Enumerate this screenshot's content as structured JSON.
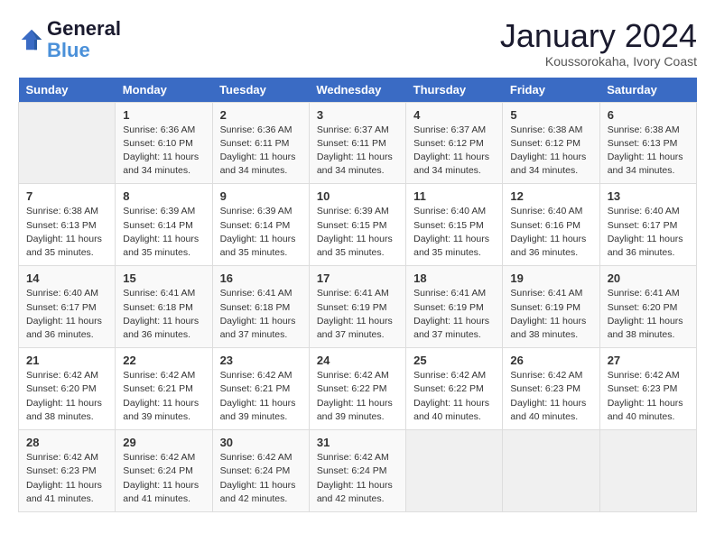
{
  "logo": {
    "line1": "General",
    "line2": "Blue"
  },
  "title": "January 2024",
  "subtitle": "Koussorokaha, Ivory Coast",
  "days_header": [
    "Sunday",
    "Monday",
    "Tuesday",
    "Wednesday",
    "Thursday",
    "Friday",
    "Saturday"
  ],
  "weeks": [
    [
      {
        "day": "",
        "sunrise": "",
        "sunset": "",
        "daylight": ""
      },
      {
        "day": "1",
        "sunrise": "Sunrise: 6:36 AM",
        "sunset": "Sunset: 6:10 PM",
        "daylight": "Daylight: 11 hours and 34 minutes."
      },
      {
        "day": "2",
        "sunrise": "Sunrise: 6:36 AM",
        "sunset": "Sunset: 6:11 PM",
        "daylight": "Daylight: 11 hours and 34 minutes."
      },
      {
        "day": "3",
        "sunrise": "Sunrise: 6:37 AM",
        "sunset": "Sunset: 6:11 PM",
        "daylight": "Daylight: 11 hours and 34 minutes."
      },
      {
        "day": "4",
        "sunrise": "Sunrise: 6:37 AM",
        "sunset": "Sunset: 6:12 PM",
        "daylight": "Daylight: 11 hours and 34 minutes."
      },
      {
        "day": "5",
        "sunrise": "Sunrise: 6:38 AM",
        "sunset": "Sunset: 6:12 PM",
        "daylight": "Daylight: 11 hours and 34 minutes."
      },
      {
        "day": "6",
        "sunrise": "Sunrise: 6:38 AM",
        "sunset": "Sunset: 6:13 PM",
        "daylight": "Daylight: 11 hours and 34 minutes."
      }
    ],
    [
      {
        "day": "7",
        "sunrise": "Sunrise: 6:38 AM",
        "sunset": "Sunset: 6:13 PM",
        "daylight": "Daylight: 11 hours and 35 minutes."
      },
      {
        "day": "8",
        "sunrise": "Sunrise: 6:39 AM",
        "sunset": "Sunset: 6:14 PM",
        "daylight": "Daylight: 11 hours and 35 minutes."
      },
      {
        "day": "9",
        "sunrise": "Sunrise: 6:39 AM",
        "sunset": "Sunset: 6:14 PM",
        "daylight": "Daylight: 11 hours and 35 minutes."
      },
      {
        "day": "10",
        "sunrise": "Sunrise: 6:39 AM",
        "sunset": "Sunset: 6:15 PM",
        "daylight": "Daylight: 11 hours and 35 minutes."
      },
      {
        "day": "11",
        "sunrise": "Sunrise: 6:40 AM",
        "sunset": "Sunset: 6:15 PM",
        "daylight": "Daylight: 11 hours and 35 minutes."
      },
      {
        "day": "12",
        "sunrise": "Sunrise: 6:40 AM",
        "sunset": "Sunset: 6:16 PM",
        "daylight": "Daylight: 11 hours and 36 minutes."
      },
      {
        "day": "13",
        "sunrise": "Sunrise: 6:40 AM",
        "sunset": "Sunset: 6:17 PM",
        "daylight": "Daylight: 11 hours and 36 minutes."
      }
    ],
    [
      {
        "day": "14",
        "sunrise": "Sunrise: 6:40 AM",
        "sunset": "Sunset: 6:17 PM",
        "daylight": "Daylight: 11 hours and 36 minutes."
      },
      {
        "day": "15",
        "sunrise": "Sunrise: 6:41 AM",
        "sunset": "Sunset: 6:18 PM",
        "daylight": "Daylight: 11 hours and 36 minutes."
      },
      {
        "day": "16",
        "sunrise": "Sunrise: 6:41 AM",
        "sunset": "Sunset: 6:18 PM",
        "daylight": "Daylight: 11 hours and 37 minutes."
      },
      {
        "day": "17",
        "sunrise": "Sunrise: 6:41 AM",
        "sunset": "Sunset: 6:19 PM",
        "daylight": "Daylight: 11 hours and 37 minutes."
      },
      {
        "day": "18",
        "sunrise": "Sunrise: 6:41 AM",
        "sunset": "Sunset: 6:19 PM",
        "daylight": "Daylight: 11 hours and 37 minutes."
      },
      {
        "day": "19",
        "sunrise": "Sunrise: 6:41 AM",
        "sunset": "Sunset: 6:19 PM",
        "daylight": "Daylight: 11 hours and 38 minutes."
      },
      {
        "day": "20",
        "sunrise": "Sunrise: 6:41 AM",
        "sunset": "Sunset: 6:20 PM",
        "daylight": "Daylight: 11 hours and 38 minutes."
      }
    ],
    [
      {
        "day": "21",
        "sunrise": "Sunrise: 6:42 AM",
        "sunset": "Sunset: 6:20 PM",
        "daylight": "Daylight: 11 hours and 38 minutes."
      },
      {
        "day": "22",
        "sunrise": "Sunrise: 6:42 AM",
        "sunset": "Sunset: 6:21 PM",
        "daylight": "Daylight: 11 hours and 39 minutes."
      },
      {
        "day": "23",
        "sunrise": "Sunrise: 6:42 AM",
        "sunset": "Sunset: 6:21 PM",
        "daylight": "Daylight: 11 hours and 39 minutes."
      },
      {
        "day": "24",
        "sunrise": "Sunrise: 6:42 AM",
        "sunset": "Sunset: 6:22 PM",
        "daylight": "Daylight: 11 hours and 39 minutes."
      },
      {
        "day": "25",
        "sunrise": "Sunrise: 6:42 AM",
        "sunset": "Sunset: 6:22 PM",
        "daylight": "Daylight: 11 hours and 40 minutes."
      },
      {
        "day": "26",
        "sunrise": "Sunrise: 6:42 AM",
        "sunset": "Sunset: 6:23 PM",
        "daylight": "Daylight: 11 hours and 40 minutes."
      },
      {
        "day": "27",
        "sunrise": "Sunrise: 6:42 AM",
        "sunset": "Sunset: 6:23 PM",
        "daylight": "Daylight: 11 hours and 40 minutes."
      }
    ],
    [
      {
        "day": "28",
        "sunrise": "Sunrise: 6:42 AM",
        "sunset": "Sunset: 6:23 PM",
        "daylight": "Daylight: 11 hours and 41 minutes."
      },
      {
        "day": "29",
        "sunrise": "Sunrise: 6:42 AM",
        "sunset": "Sunset: 6:24 PM",
        "daylight": "Daylight: 11 hours and 41 minutes."
      },
      {
        "day": "30",
        "sunrise": "Sunrise: 6:42 AM",
        "sunset": "Sunset: 6:24 PM",
        "daylight": "Daylight: 11 hours and 42 minutes."
      },
      {
        "day": "31",
        "sunrise": "Sunrise: 6:42 AM",
        "sunset": "Sunset: 6:24 PM",
        "daylight": "Daylight: 11 hours and 42 minutes."
      },
      {
        "day": "",
        "sunrise": "",
        "sunset": "",
        "daylight": ""
      },
      {
        "day": "",
        "sunrise": "",
        "sunset": "",
        "daylight": ""
      },
      {
        "day": "",
        "sunrise": "",
        "sunset": "",
        "daylight": ""
      }
    ]
  ]
}
